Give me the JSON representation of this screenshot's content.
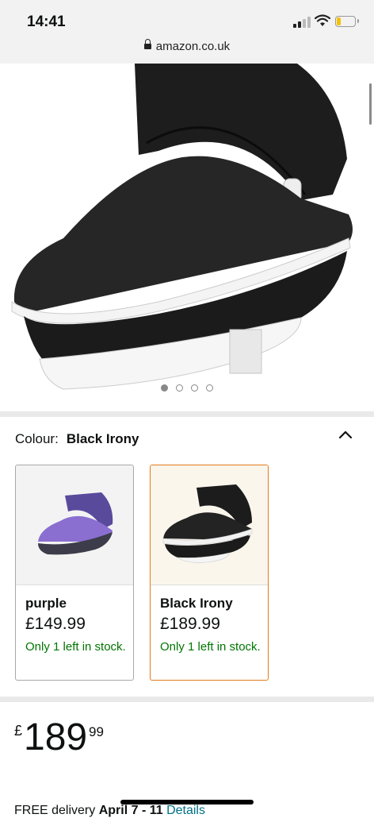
{
  "status_bar": {
    "time": "14:41",
    "url": "amazon.co.uk"
  },
  "carousel": {
    "image_count": 4,
    "active_index": 0
  },
  "colour": {
    "label": "Colour:",
    "selected": "Black Irony",
    "options": [
      {
        "name": "purple",
        "price": "£149.99",
        "stock": "Only 1 left in stock.",
        "color": "#8a6fd0"
      },
      {
        "name": "Black Irony",
        "price": "£189.99",
        "stock": "Only 1 left in stock.",
        "color": "#1e1e1e"
      }
    ]
  },
  "price": {
    "currency": "£",
    "whole": "189",
    "fraction": "99"
  },
  "delivery": {
    "prefix": "FREE delivery",
    "date": "April 7 - 11",
    "details_link": "Details"
  },
  "colors": {
    "accent_border": "#e07b1d",
    "stock_green": "#007600",
    "link_blue": "#007185"
  }
}
